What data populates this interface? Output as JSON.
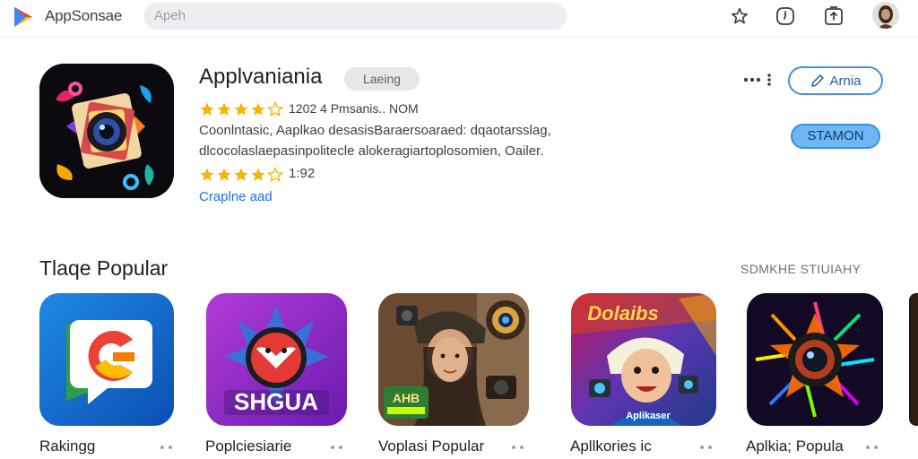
{
  "header": {
    "brand": "AppSonsae",
    "search_placeholder": "Apeh",
    "icons": [
      "logo-icon",
      "star-icon",
      "clock-icon",
      "share-icon",
      "avatar"
    ]
  },
  "featured": {
    "title": "Applvaniania",
    "badge": "Laeing",
    "rating_stars": 4,
    "rating_meta": "1202 4 Pmsanis.. NOM",
    "description_lines": [
      "Coonlntasic, Aaplkao desasisBaraersoaraed: dqaotarsslag,",
      "dlcocolaslaepasinpolitecle alokeragiartoplosomien, Oailer."
    ],
    "rating2_stars": 4,
    "rating2_count": "1:92",
    "link_text": "Craplne aad",
    "more_label": "more-options",
    "action_outline_label": "Arnia",
    "action_filled_label": "STAMON"
  },
  "section": {
    "title": "Tlaqe Popular",
    "see_all": "SDMKHE STIUIAHY",
    "items": [
      {
        "label": "Rakingg",
        "icon": "swirl-chat-icon"
      },
      {
        "label": "Poplciesiarie",
        "icon": "fox-emblem-icon"
      },
      {
        "label": "Voplasi Popular",
        "icon": "photographer-icon"
      },
      {
        "label": "Apllkories ic",
        "icon": "player-camera-icon"
      },
      {
        "label": "Aplkia; Popula",
        "icon": "neon-lens-icon"
      }
    ],
    "emblem_text": "SHGUA",
    "photo_badge": "AHB",
    "poster_text": "Dolaibs",
    "poster_caption": "Aplikaser"
  },
  "colors": {
    "accent": "#1a73e8",
    "star": "#f4b400",
    "button_fill": "#6fb7f3"
  }
}
